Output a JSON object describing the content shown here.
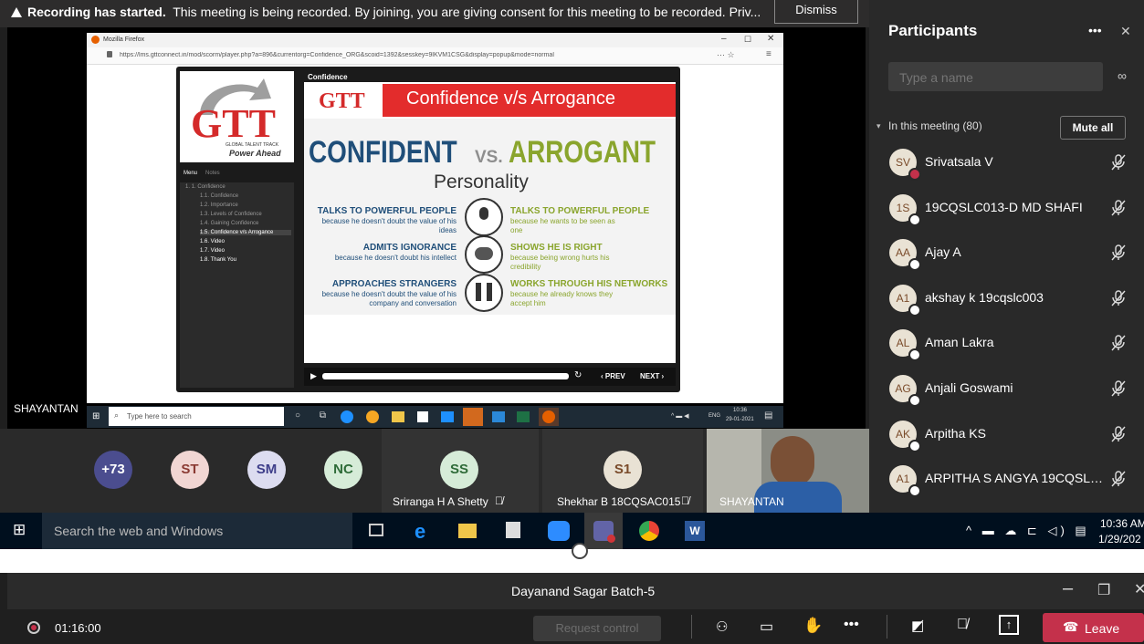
{
  "banner": {
    "title": "Recording has started.",
    "message": "This meeting is being recorded. By joining, you are giving consent for this meeting to be recorded. Priv...",
    "dismiss": "Dismiss"
  },
  "browser": {
    "title": "Mozilla Firefox",
    "url": "https://lms.gttconnect.in/mod/scorm/player.php?a=896&currentorg=Confidence_ORG&scoid=1392&sesskey=9lKVM1CSG&display=popup&mode=normal"
  },
  "course": {
    "header": "Confidence",
    "logo_line1": "GLOBAL TALENT TRACK",
    "logo_line2": "Power Ahead",
    "menu_tab": "Menu",
    "notes_tab": "Notes",
    "menu_items": [
      "1. 1. Confidence",
      "1.1. Confidence",
      "1.2. Importance",
      "1.3. Levels of Confidence",
      "1.4. Gaining Confidence",
      "1.5. Confidence v/s Arrogance",
      "1.6. Video",
      "1.7. Video",
      "1.8. Thank You"
    ],
    "slide_title": "Confidence v/s Arrogance",
    "headline_left": "CONFIDENT",
    "headline_vs": "VS.",
    "headline_right": "ARROGANT",
    "subheading": "Personality",
    "left_rows": [
      {
        "title": "TALKS TO POWERFUL PEOPLE",
        "sub": "because he doesn't doubt the value of his ideas"
      },
      {
        "title": "ADMITS IGNORANCE",
        "sub": "because he doesn't doubt his intellect"
      },
      {
        "title": "APPROACHES STRANGERS",
        "sub": "because he doesn't doubt the value of his company and conversation"
      }
    ],
    "right_rows": [
      {
        "title": "TALKS TO POWERFUL PEOPLE",
        "sub": "because he wants to be seen as one"
      },
      {
        "title": "SHOWS HE IS RIGHT",
        "sub": "because being wrong hurts his credibility"
      },
      {
        "title": "WORKS THROUGH HIS NETWORKS",
        "sub": "because he already knows they accept him"
      }
    ],
    "prev": "‹ PREV",
    "next": "NEXT ›"
  },
  "presenter_label": "SHAYANTAN",
  "inner_taskbar": {
    "search": "Type here to search",
    "lang": "ENG",
    "time": "10:36",
    "date": "29-01-2021"
  },
  "video_strip": {
    "bubbles": [
      {
        "initials": "+73",
        "bg": "#4b4d8f",
        "fg": "#ffffff"
      },
      {
        "initials": "ST",
        "bg": "#f1d6d3",
        "fg": "#8a3a32"
      },
      {
        "initials": "SM",
        "bg": "#dcdcf0",
        "fg": "#3e3e8a"
      },
      {
        "initials": "NC",
        "bg": "#d6ecd8",
        "fg": "#2e6b38"
      }
    ],
    "tiles": [
      {
        "initials": "SS",
        "name": "Sriranga H A Shetty",
        "bg": "#d6ecd8",
        "fg": "#2e6b38"
      },
      {
        "initials": "S1",
        "name": "Shekhar B 18CQSAC015",
        "bg": "#e9e2d4",
        "fg": "#7a4b2a"
      }
    ],
    "video_name": "SHAYANTAN"
  },
  "taskbar": {
    "search": "Search the web and Windows",
    "time": "10:36 AM",
    "date": "1/29/202"
  },
  "meeting": {
    "title": "Dayanand Sagar Batch-5",
    "timer": "01:16:00",
    "request_control": "Request control",
    "leave": "Leave"
  },
  "participants": {
    "title": "Participants",
    "search_placeholder": "Type a name",
    "section": "In this meeting (80)",
    "mute_all": "Mute all",
    "list": [
      {
        "initials": "SV",
        "name": "Srivatsala V",
        "status": "#c4314b"
      },
      {
        "initials": "1S",
        "name": "19CQSLC013-D MD SHAFI",
        "status": "#ffffff"
      },
      {
        "initials": "AA",
        "name": "Ajay A",
        "status": "#ffffff"
      },
      {
        "initials": "A1",
        "name": "akshay k 19cqslc003",
        "status": "#ffffff"
      },
      {
        "initials": "AL",
        "name": "Aman Lakra",
        "status": "#ffffff"
      },
      {
        "initials": "AG",
        "name": "Anjali Goswami",
        "status": "#ffffff"
      },
      {
        "initials": "AK",
        "name": "Arpitha KS",
        "status": "#ffffff"
      },
      {
        "initials": "A1",
        "name": "ARPITHA S ANGYA 19CQSLC0...",
        "status": "#ffffff"
      }
    ]
  },
  "colors": {
    "accent": "#6264a7",
    "leave": "#c4314b",
    "slide_blue": "#1f4e79",
    "slide_green": "#8aa52d",
    "slide_red": "#e32c2c"
  }
}
